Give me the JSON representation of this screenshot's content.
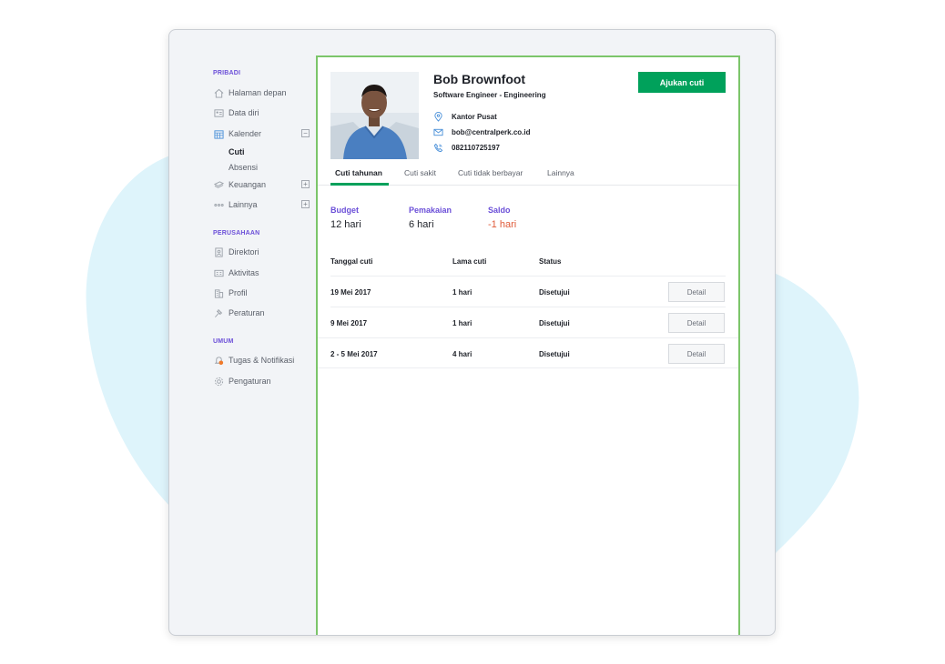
{
  "sidebar": {
    "sections": [
      {
        "title": "PRIBADI"
      },
      {
        "title": "PERUSAHAAN"
      },
      {
        "title": "UMUM"
      }
    ],
    "items": {
      "home": "Halaman depan",
      "profile_data": "Data diri",
      "calendar": "Kalender",
      "leave": "Cuti",
      "absence": "Absensi",
      "finance": "Keuangan",
      "others": "Lainnya",
      "directory": "Direktori",
      "activities": "Aktivitas",
      "company_profile": "Profil",
      "rules": "Peraturan",
      "tasks": "Tugas & Notifikasi",
      "settings": "Pengaturan"
    },
    "calendar_toggle": "−",
    "finance_toggle": "+",
    "others_toggle": "+",
    "tasks_badge_icon": "notification-badge-icon"
  },
  "profile": {
    "name": "Bob Brownfoot",
    "role": "Software Engineer - Engineering",
    "office": "Kantor Pusat",
    "email": "bob@centralperk.co.id",
    "phone": "082110725197"
  },
  "actions": {
    "apply_leave": "Ajukan cuti"
  },
  "tabs": [
    "Cuti tahunan",
    "Cuti sakit",
    "Cuti tidak berbayar",
    "Lainnya"
  ],
  "stats": {
    "budget_label": "Budget",
    "budget_value": "12 hari",
    "usage_label": "Pemakaian",
    "usage_value": "6 hari",
    "balance_label": "Saldo",
    "balance_value": "-1 hari"
  },
  "table": {
    "headers": [
      "Tanggal cuti",
      "Lama cuti",
      "Status"
    ],
    "rows": [
      {
        "date": "19 Mei 2017",
        "duration": "1 hari",
        "status": "Disetujui",
        "action": "Detail"
      },
      {
        "date": "9 Mei 2017",
        "duration": "1 hari",
        "status": "Disetujui",
        "action": "Detail"
      },
      {
        "date": "2 - 5 Mei 2017",
        "duration": "4 hari",
        "status": "Disetujui",
        "action": "Detail"
      }
    ]
  },
  "colors": {
    "accent_green": "#00a15b",
    "section_purple": "#6b4fd8",
    "negative": "#e05b3a",
    "panel_border": "#7cc56a",
    "blob": "#def4fb"
  }
}
